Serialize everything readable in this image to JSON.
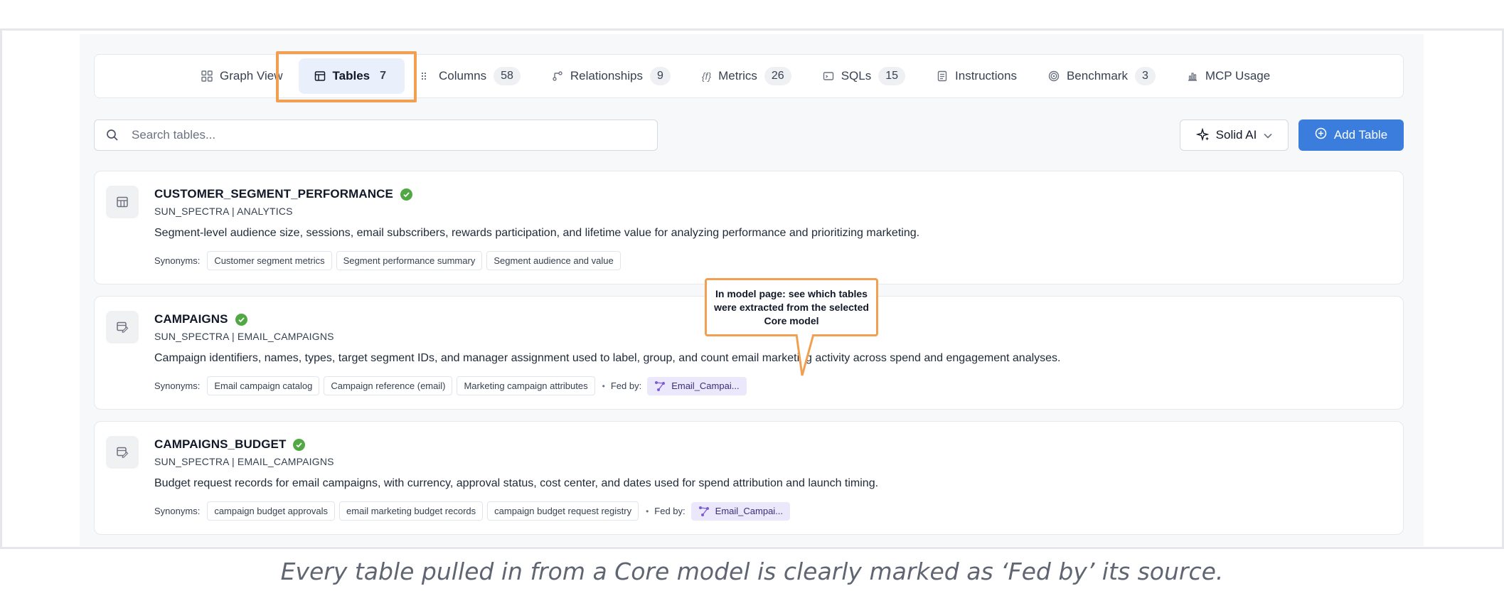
{
  "tabs": [
    {
      "label": "Graph View",
      "count": "",
      "icon": "graph-view-icon"
    },
    {
      "label": "Tables",
      "count": "7",
      "icon": "table-icon"
    },
    {
      "label": "Columns",
      "count": "58",
      "icon": "columns-icon"
    },
    {
      "label": "Relationships",
      "count": "9",
      "icon": "relationships-icon"
    },
    {
      "label": "Metrics",
      "count": "26",
      "icon": "function-icon"
    },
    {
      "label": "SQLs",
      "count": "15",
      "icon": "sql-icon"
    },
    {
      "label": "Instructions",
      "count": "",
      "icon": "instructions-icon"
    },
    {
      "label": "Benchmark",
      "count": "3",
      "icon": "target-icon"
    },
    {
      "label": "MCP Usage",
      "count": "",
      "icon": "chart-icon"
    }
  ],
  "active_tab": "Tables",
  "search": {
    "placeholder": "Search tables..."
  },
  "ai_button": {
    "label": "Solid AI"
  },
  "add_button": {
    "label": "Add Table"
  },
  "synonyms_label": "Synonyms:",
  "fed_label": "Fed by:",
  "tables": [
    {
      "name": "CUSTOMER_SEGMENT_PERFORMANCE",
      "schema": "SUN_SPECTRA | ANALYTICS",
      "description": "Segment-level audience size, sessions, email subscribers, rewards participation, and lifetime value for analyzing performance and prioritizing marketing.",
      "synonyms": [
        "Customer segment metrics",
        "Segment performance summary",
        "Segment audience and value"
      ],
      "fed_by": ""
    },
    {
      "name": "CAMPAIGNS",
      "schema": "SUN_SPECTRA | EMAIL_CAMPAIGNS",
      "description": "Campaign identifiers, names, types, target segment IDs, and manager assignment used to label, group, and count email marketing activity across spend and engagement analyses.",
      "synonyms": [
        "Email campaign catalog",
        "Campaign reference (email)",
        "Marketing campaign attributes"
      ],
      "fed_by": "Email_Campai..."
    },
    {
      "name": "CAMPAIGNS_BUDGET",
      "schema": "SUN_SPECTRA | EMAIL_CAMPAIGNS",
      "description": "Budget request records for email campaigns, with currency, approval status, cost center, and dates used for spend attribution and launch timing.",
      "synonyms": [
        "campaign budget approvals",
        "email marketing budget records",
        "campaign budget request registry"
      ],
      "fed_by": "Email_Campai..."
    }
  ],
  "callout": "In model page: see which tables were extracted from the selected Core model",
  "caption": "Every table pulled in from a Core model is clearly marked as ‘Fed by’ its source.",
  "colors": {
    "accent": "#3b7ddd",
    "highlight": "#f0a050",
    "verified": "#52a845",
    "fed_chip": "#ece8fb"
  }
}
